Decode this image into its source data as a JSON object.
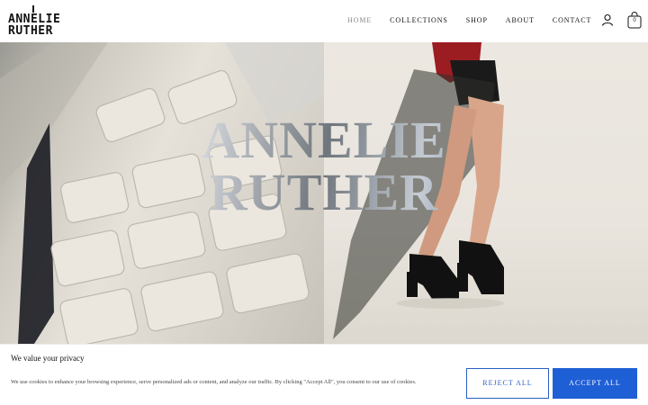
{
  "brand": {
    "logo_line1": "ANNELIE",
    "logo_line2": "RUTHER"
  },
  "nav": {
    "items": [
      {
        "label": "HOME",
        "active": true
      },
      {
        "label": "COLLECTIONS",
        "active": false
      },
      {
        "label": "SHOP",
        "active": false
      },
      {
        "label": "ABOUT",
        "active": false
      },
      {
        "label": "CONTACT",
        "active": false
      }
    ]
  },
  "header_icons": {
    "account": "user-icon",
    "cart": "shopping-bag-icon",
    "cart_count": "0"
  },
  "hero": {
    "title_line1": "ANNELIE",
    "title_line2": "RUTHER",
    "left_image": "quilted-white-coat-closeup",
    "right_image": "model-sheer-skirt-platform-heels"
  },
  "cookie_banner": {
    "title": "We value your privacy",
    "text": "We use cookies to enhance your browsing experience, serve personalized ads or content, and analyze our traffic. By clicking \"Accept All\", you consent to our use of cookies.",
    "reject_label": "REJECT ALL",
    "accept_label": "ACCEPT ALL"
  },
  "colors": {
    "accent": "#1f5fd6",
    "nav_active": "#8a8a8a",
    "text": "#111111"
  }
}
